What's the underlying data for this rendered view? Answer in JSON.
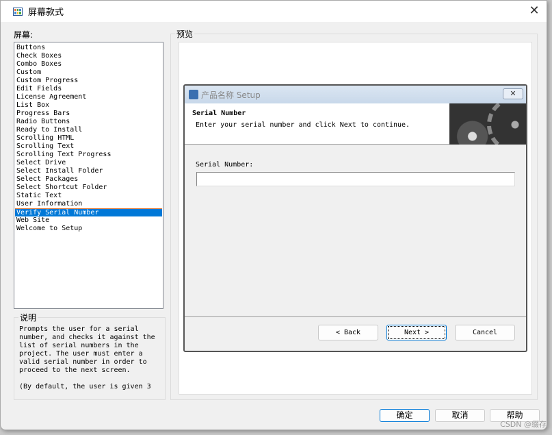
{
  "window": {
    "title": "屏幕款式",
    "close_icon": "close-icon"
  },
  "screens": {
    "label": "屏幕:",
    "items": [
      "Buttons",
      "Check Boxes",
      "Combo Boxes",
      "Custom",
      "Custom Progress",
      "Edit Fields",
      "License Agreement",
      "List Box",
      "Progress Bars",
      "Radio Buttons",
      "Ready to Install",
      "Scrolling HTML",
      "Scrolling Text",
      "Scrolling Text Progress",
      "Select Drive",
      "Select Install Folder",
      "Select Packages",
      "Select Shortcut Folder",
      "Static Text",
      "User Information",
      "Verify Serial Number",
      "Web Site",
      "Welcome to Setup"
    ],
    "selected": "Verify Serial Number"
  },
  "description": {
    "label": "说明",
    "text": "Prompts the user for a serial number, and checks it against the list of serial numbers in the project. The user must enter a valid serial number in order to proceed to the next screen.\n\n(By default, the user is given 3"
  },
  "preview": {
    "label": "预览",
    "setup": {
      "title": "产品名称 Setup",
      "close": "✕",
      "heading": "Serial Number",
      "subheading": "Enter your serial number and click Next to continue.",
      "field_label": "Serial Number:",
      "field_value": "",
      "back": "< Back",
      "next": "Next >",
      "cancel": "Cancel"
    }
  },
  "buttons": {
    "ok": "确定",
    "cancel": "取消",
    "help": "帮助"
  },
  "watermark": "CSDN @缀存",
  "colors": {
    "selection": "#0078d7"
  }
}
